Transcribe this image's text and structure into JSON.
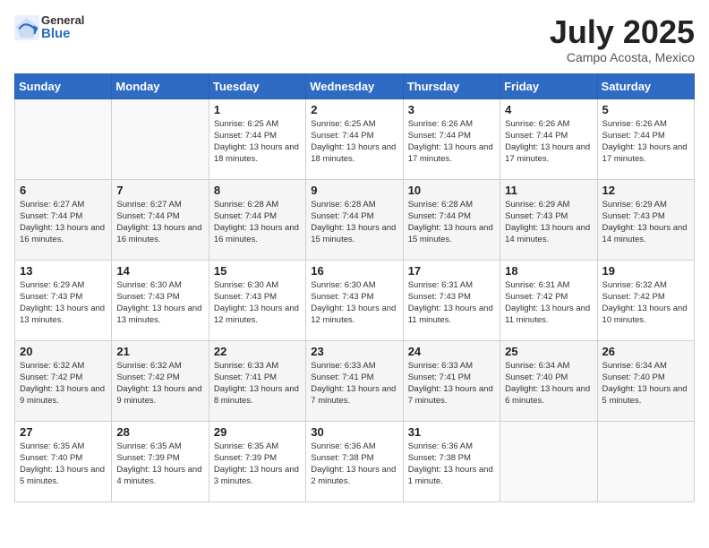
{
  "header": {
    "logo_general": "General",
    "logo_blue": "Blue",
    "month_title": "July 2025",
    "location": "Campo Acosta, Mexico"
  },
  "days_of_week": [
    "Sunday",
    "Monday",
    "Tuesday",
    "Wednesday",
    "Thursday",
    "Friday",
    "Saturday"
  ],
  "weeks": [
    [
      {
        "day": "",
        "info": ""
      },
      {
        "day": "",
        "info": ""
      },
      {
        "day": "1",
        "info": "Sunrise: 6:25 AM\nSunset: 7:44 PM\nDaylight: 13 hours and 18 minutes."
      },
      {
        "day": "2",
        "info": "Sunrise: 6:25 AM\nSunset: 7:44 PM\nDaylight: 13 hours and 18 minutes."
      },
      {
        "day": "3",
        "info": "Sunrise: 6:26 AM\nSunset: 7:44 PM\nDaylight: 13 hours and 17 minutes."
      },
      {
        "day": "4",
        "info": "Sunrise: 6:26 AM\nSunset: 7:44 PM\nDaylight: 13 hours and 17 minutes."
      },
      {
        "day": "5",
        "info": "Sunrise: 6:26 AM\nSunset: 7:44 PM\nDaylight: 13 hours and 17 minutes."
      }
    ],
    [
      {
        "day": "6",
        "info": "Sunrise: 6:27 AM\nSunset: 7:44 PM\nDaylight: 13 hours and 16 minutes."
      },
      {
        "day": "7",
        "info": "Sunrise: 6:27 AM\nSunset: 7:44 PM\nDaylight: 13 hours and 16 minutes."
      },
      {
        "day": "8",
        "info": "Sunrise: 6:28 AM\nSunset: 7:44 PM\nDaylight: 13 hours and 16 minutes."
      },
      {
        "day": "9",
        "info": "Sunrise: 6:28 AM\nSunset: 7:44 PM\nDaylight: 13 hours and 15 minutes."
      },
      {
        "day": "10",
        "info": "Sunrise: 6:28 AM\nSunset: 7:44 PM\nDaylight: 13 hours and 15 minutes."
      },
      {
        "day": "11",
        "info": "Sunrise: 6:29 AM\nSunset: 7:43 PM\nDaylight: 13 hours and 14 minutes."
      },
      {
        "day": "12",
        "info": "Sunrise: 6:29 AM\nSunset: 7:43 PM\nDaylight: 13 hours and 14 minutes."
      }
    ],
    [
      {
        "day": "13",
        "info": "Sunrise: 6:29 AM\nSunset: 7:43 PM\nDaylight: 13 hours and 13 minutes."
      },
      {
        "day": "14",
        "info": "Sunrise: 6:30 AM\nSunset: 7:43 PM\nDaylight: 13 hours and 13 minutes."
      },
      {
        "day": "15",
        "info": "Sunrise: 6:30 AM\nSunset: 7:43 PM\nDaylight: 13 hours and 12 minutes."
      },
      {
        "day": "16",
        "info": "Sunrise: 6:30 AM\nSunset: 7:43 PM\nDaylight: 13 hours and 12 minutes."
      },
      {
        "day": "17",
        "info": "Sunrise: 6:31 AM\nSunset: 7:43 PM\nDaylight: 13 hours and 11 minutes."
      },
      {
        "day": "18",
        "info": "Sunrise: 6:31 AM\nSunset: 7:42 PM\nDaylight: 13 hours and 11 minutes."
      },
      {
        "day": "19",
        "info": "Sunrise: 6:32 AM\nSunset: 7:42 PM\nDaylight: 13 hours and 10 minutes."
      }
    ],
    [
      {
        "day": "20",
        "info": "Sunrise: 6:32 AM\nSunset: 7:42 PM\nDaylight: 13 hours and 9 minutes."
      },
      {
        "day": "21",
        "info": "Sunrise: 6:32 AM\nSunset: 7:42 PM\nDaylight: 13 hours and 9 minutes."
      },
      {
        "day": "22",
        "info": "Sunrise: 6:33 AM\nSunset: 7:41 PM\nDaylight: 13 hours and 8 minutes."
      },
      {
        "day": "23",
        "info": "Sunrise: 6:33 AM\nSunset: 7:41 PM\nDaylight: 13 hours and 7 minutes."
      },
      {
        "day": "24",
        "info": "Sunrise: 6:33 AM\nSunset: 7:41 PM\nDaylight: 13 hours and 7 minutes."
      },
      {
        "day": "25",
        "info": "Sunrise: 6:34 AM\nSunset: 7:40 PM\nDaylight: 13 hours and 6 minutes."
      },
      {
        "day": "26",
        "info": "Sunrise: 6:34 AM\nSunset: 7:40 PM\nDaylight: 13 hours and 5 minutes."
      }
    ],
    [
      {
        "day": "27",
        "info": "Sunrise: 6:35 AM\nSunset: 7:40 PM\nDaylight: 13 hours and 5 minutes."
      },
      {
        "day": "28",
        "info": "Sunrise: 6:35 AM\nSunset: 7:39 PM\nDaylight: 13 hours and 4 minutes."
      },
      {
        "day": "29",
        "info": "Sunrise: 6:35 AM\nSunset: 7:39 PM\nDaylight: 13 hours and 3 minutes."
      },
      {
        "day": "30",
        "info": "Sunrise: 6:36 AM\nSunset: 7:38 PM\nDaylight: 13 hours and 2 minutes."
      },
      {
        "day": "31",
        "info": "Sunrise: 6:36 AM\nSunset: 7:38 PM\nDaylight: 13 hours and 1 minute."
      },
      {
        "day": "",
        "info": ""
      },
      {
        "day": "",
        "info": ""
      }
    ]
  ]
}
